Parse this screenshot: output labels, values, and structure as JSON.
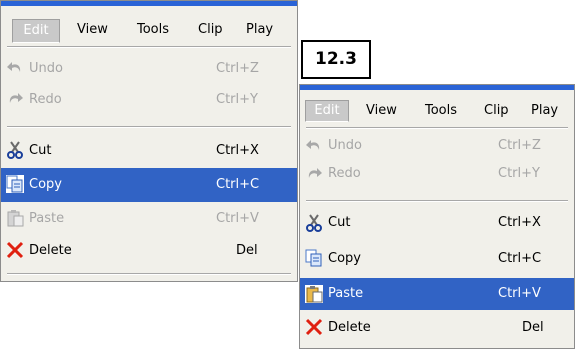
{
  "menubar": {
    "titles": [
      "Edit",
      "View",
      "Tools",
      "Clip",
      "Play"
    ]
  },
  "badge": {
    "text": "12.3"
  },
  "left_menu": {
    "items": [
      {
        "label": "Undo",
        "shortcut": "Ctrl+Z",
        "icon": "undo-icon",
        "state": "disabled"
      },
      {
        "label": "Redo",
        "shortcut": "Ctrl+Y",
        "icon": "redo-icon",
        "state": "disabled"
      },
      {
        "label": "Cut",
        "shortcut": "Ctrl+X",
        "icon": "scissors-icon",
        "state": "enabled"
      },
      {
        "label": "Copy",
        "shortcut": "Ctrl+C",
        "icon": "copy-icon",
        "state": "highlighted"
      },
      {
        "label": "Paste",
        "shortcut": "Ctrl+V",
        "icon": "paste-icon",
        "state": "disabled"
      },
      {
        "label": "Delete",
        "shortcut": "Del",
        "icon": "delete-x-icon",
        "state": "enabled"
      }
    ]
  },
  "right_menu": {
    "items": [
      {
        "label": "Undo",
        "shortcut": "Ctrl+Z",
        "icon": "undo-icon",
        "state": "disabled"
      },
      {
        "label": "Redo",
        "shortcut": "Ctrl+Y",
        "icon": "redo-icon",
        "state": "disabled"
      },
      {
        "label": "Cut",
        "shortcut": "Ctrl+X",
        "icon": "scissors-icon",
        "state": "enabled"
      },
      {
        "label": "Copy",
        "shortcut": "Ctrl+C",
        "icon": "copy-icon",
        "state": "enabled"
      },
      {
        "label": "Paste",
        "shortcut": "Ctrl+V",
        "icon": "paste-icon",
        "state": "highlighted"
      },
      {
        "label": "Delete",
        "shortcut": "Del",
        "icon": "delete-x-icon",
        "state": "enabled"
      }
    ]
  },
  "colors": {
    "highlight": "#3163c5",
    "titlebar": "#2a63d6",
    "menu_bg": "#f1f0ea",
    "disabled_text": "#a6a6a6",
    "delete_icon": "#e02010"
  }
}
